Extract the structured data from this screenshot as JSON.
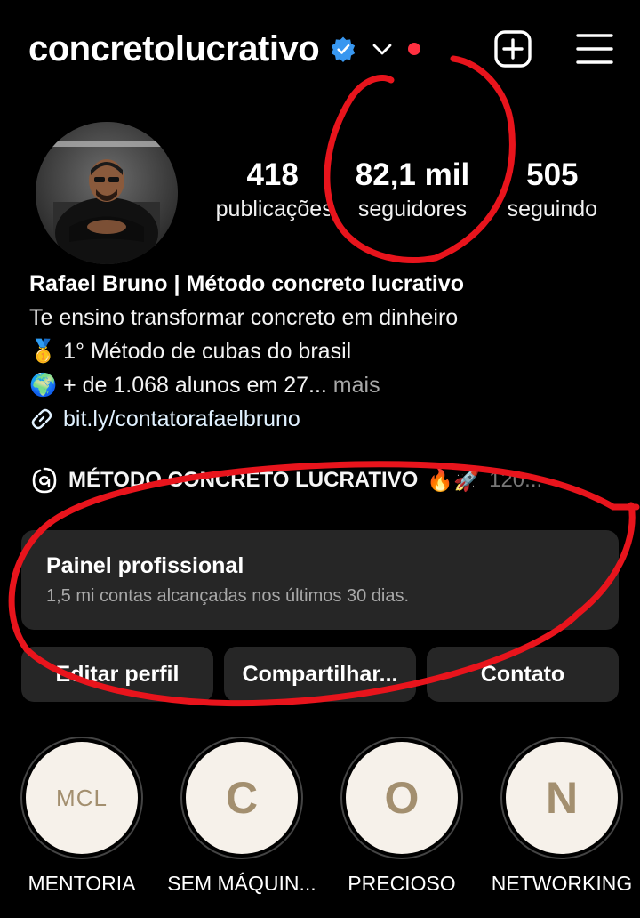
{
  "header": {
    "username": "concretolucrativo",
    "icons": {
      "verified": "verified-badge-icon",
      "chevron": "chevron-down-icon",
      "create": "plus-square-icon",
      "menu": "hamburger-menu-icon"
    },
    "notification_dot_color": "#ff3040"
  },
  "stats": [
    {
      "value": "418",
      "label": "publicações"
    },
    {
      "value": "82,1 mil",
      "label": "seguidores"
    },
    {
      "value": "505",
      "label": "seguindo"
    }
  ],
  "bio": {
    "name": "Rafael Bruno | Método concreto lucrativo",
    "line1": "Te ensino transformar concreto em dinheiro",
    "line2_emoji": "🥇",
    "line2": "1° Método de cubas do brasil",
    "line3_emoji": "🌍",
    "line3": "+ de 1.068 alunos em 27...",
    "more": "mais",
    "link": "bit.ly/contatorafaelbruno"
  },
  "thread": {
    "text": "MÉTODO CONCRETO LUCRATIVO",
    "emoji": "🔥🚀",
    "trailing": "120..."
  },
  "dashboard": {
    "title": "Painel profissional",
    "subtitle": "1,5 mi contas alcançadas nos últimos 30 dias."
  },
  "actions": {
    "edit": "Editar perfil",
    "share": "Compartilhar...",
    "contact": "Contato"
  },
  "highlights": [
    {
      "label": "MENTORIA",
      "glyph": "MCL"
    },
    {
      "label": "SEM MÁQUIN...",
      "glyph": "C"
    },
    {
      "label": "PRECIOSO",
      "glyph": "O"
    },
    {
      "label": "NETWORKING",
      "glyph": "N"
    }
  ],
  "colors": {
    "background": "#000000",
    "card": "#262626",
    "verified": "#3897f0",
    "annotation": "#e8141c",
    "highlight_glyph": "#a38f6f"
  }
}
